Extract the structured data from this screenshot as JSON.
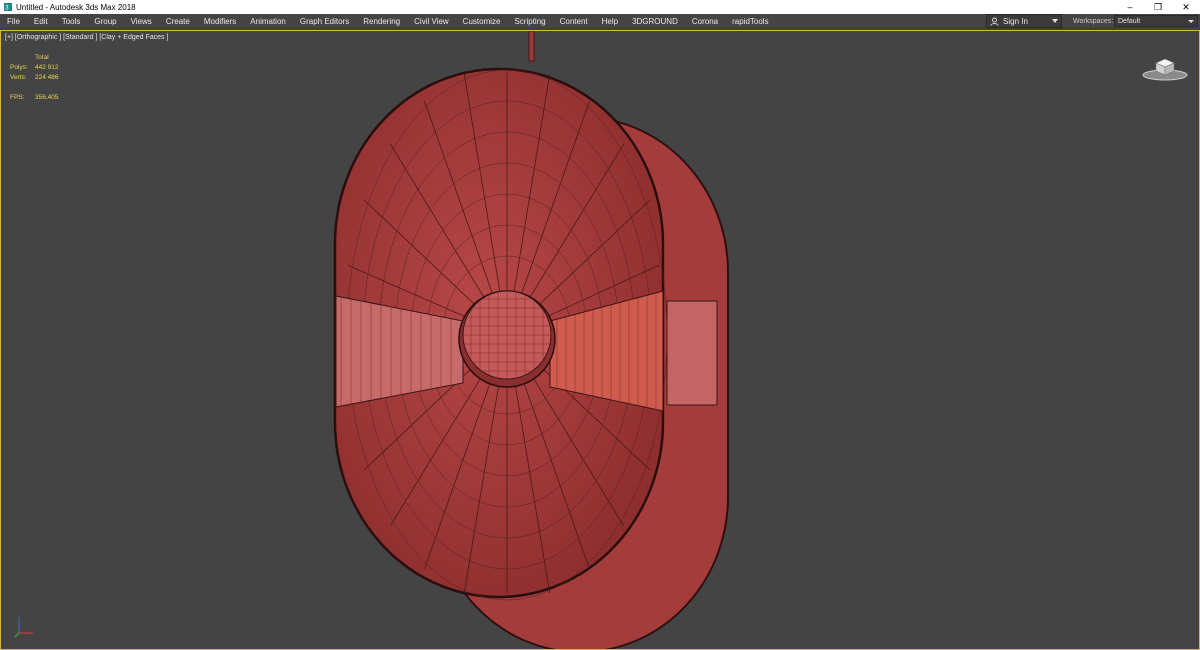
{
  "window": {
    "title": "Untitled - Autodesk 3ds Max 2018",
    "controls": {
      "minimize": "–",
      "restore": "❐",
      "close": "✕"
    }
  },
  "menu": {
    "items": [
      "File",
      "Edit",
      "Tools",
      "Group",
      "Views",
      "Create",
      "Modifiers",
      "Animation",
      "Graph Editors",
      "Rendering",
      "Civil View",
      "Customize",
      "Scripting",
      "Content",
      "Help",
      "3DGROUND",
      "Corona",
      "rapidTools"
    ],
    "sign_in": "Sign In",
    "workspaces_label": "Workspaces:",
    "workspaces_value": "Default"
  },
  "viewport": {
    "label": "[+] [Orthographic ] [Standard ] [Clay + Edged Faces ]",
    "stats": {
      "header": "Total",
      "polys_label": "Polys:",
      "polys_value": "442 912",
      "verts_label": "Verts:",
      "verts_value": "224 486",
      "fps_label": "FPS:",
      "fps_value": "356,405"
    }
  },
  "colors": {
    "viewport_bg": "#444444",
    "viewport_border": "#d6b44a",
    "stats_text": "#e8d25a",
    "model_fill": "#b04444",
    "model_edges": "#3a1414"
  },
  "icons": {
    "app": "3dsmax-icon",
    "user": "user-icon",
    "viewcube": "viewcube-icon",
    "axis": "axis-tripod-icon"
  }
}
